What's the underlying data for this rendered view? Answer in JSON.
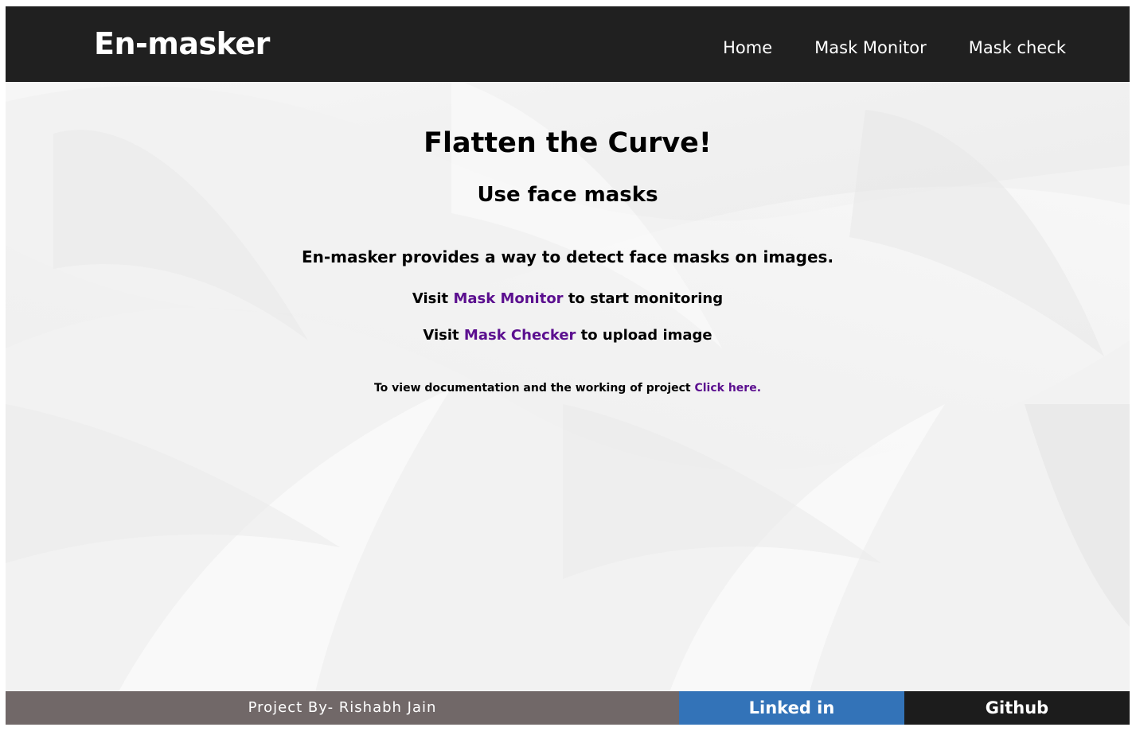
{
  "navbar": {
    "brand": "En-masker",
    "links": [
      "Home",
      "Mask Monitor",
      "Mask check"
    ]
  },
  "hero": {
    "title": "Flatten the Curve!",
    "subtitle": "Use face masks",
    "description": "En-masker provides a way to detect face masks on images.",
    "visit_monitor": {
      "prefix": "Visit ",
      "link": "Mask Monitor",
      "suffix": " to start monitoring"
    },
    "visit_checker": {
      "prefix": "Visit ",
      "link": "Mask Checker",
      "suffix": " to upload image"
    },
    "docs": {
      "text": "To view documentation and the working of project ",
      "link": "Click here."
    }
  },
  "footer": {
    "credit": "Project By- Rishabh Jain",
    "linkedin": "Linked in",
    "github": "Github"
  },
  "colors": {
    "navbar_bg": "#202020",
    "link_purple": "#5b0f8f",
    "footer_credit_bg": "#716868",
    "footer_linkedin_bg": "#3373b8",
    "footer_github_bg": "#1c1c1c"
  }
}
